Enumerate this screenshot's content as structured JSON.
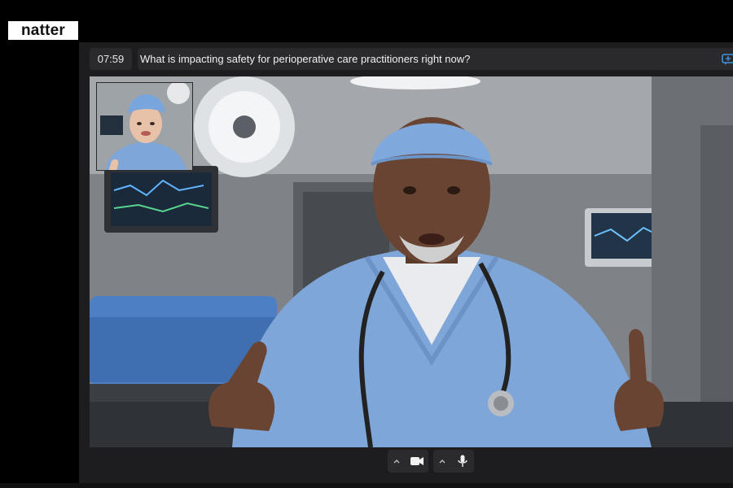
{
  "brand": {
    "logo_text": "natter"
  },
  "session": {
    "timer": "07:59",
    "question": "What is impacting safety for perioperative care practitioners right now?"
  },
  "icons": {
    "chat": "chat-icon",
    "camera": "video-camera-icon",
    "microphone": "microphone-icon",
    "chevron": "chevron-up-icon"
  },
  "colors": {
    "page_background": "#000000",
    "panel_background": "#1d1d1f",
    "bar_background": "#2a2a2d",
    "accent": "#3f8fdc",
    "scrubs": "#7ea6d8"
  }
}
